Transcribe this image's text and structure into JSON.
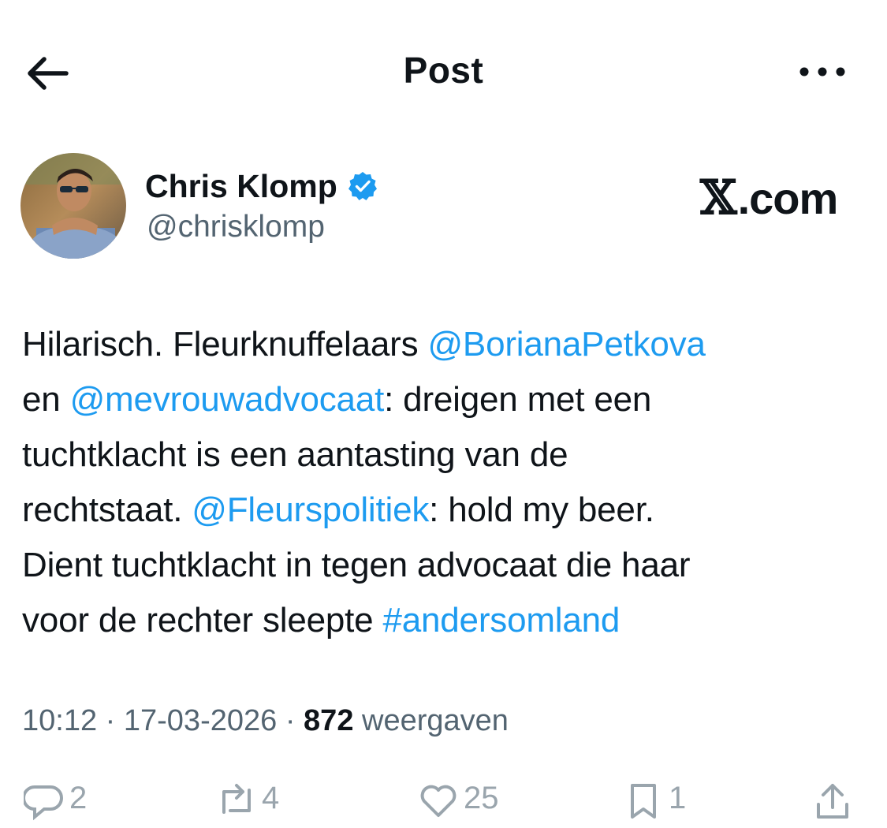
{
  "header": {
    "title": "Post",
    "back_icon": "arrow-left-icon",
    "more_icon": "more-horizontal-icon"
  },
  "author": {
    "name": "Chris Klomp",
    "handle": "@chrisklomp",
    "verified_icon": "verified-badge-icon",
    "verified_color": "#1d9bf0"
  },
  "watermark": {
    "text": ".com",
    "logo": "𝕏"
  },
  "tweet": {
    "lines": [
      [
        {
          "t": "Hilarisch. Fleurknuffelaars ",
          "link": false
        },
        {
          "t": "@BorianaPetkova",
          "link": true
        }
      ],
      [
        {
          "t": "en ",
          "link": false
        },
        {
          "t": "@mevrouwadvocaat",
          "link": true
        },
        {
          "t": ": dreigen met een",
          "link": false
        }
      ],
      [
        {
          "t": "tuchtklacht is een aantasting van de",
          "link": false
        }
      ],
      [
        {
          "t": "rechtstaat. ",
          "link": false
        },
        {
          "t": "@Fleurspolitiek",
          "link": true
        },
        {
          "t": ": hold my beer.",
          "link": false
        }
      ],
      [
        {
          "t": "Dient tuchtklacht in tegen advocaat die haar",
          "link": false
        }
      ],
      [
        {
          "t": "voor de rechter sleepte ",
          "link": false
        },
        {
          "t": "#andersomland",
          "link": true
        }
      ]
    ]
  },
  "meta": {
    "time": "10:12",
    "date": "17-03-2026",
    "separator": " · ",
    "views_count": "872",
    "views_label": "weergaven"
  },
  "actions": {
    "replies": "2",
    "reposts": "4",
    "likes": "25",
    "bookmarks": "1"
  },
  "colors": {
    "text": "#0f1419",
    "secondary": "#536471",
    "link": "#1d9bf0",
    "icon_muted": "#9aa5ad"
  }
}
